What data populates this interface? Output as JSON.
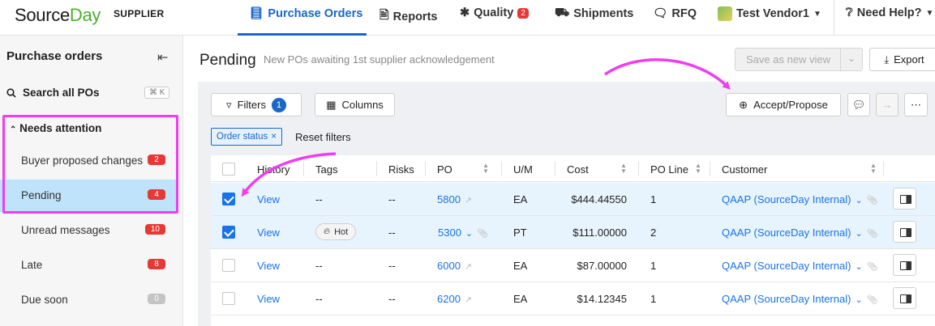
{
  "header": {
    "logo_source": "Source",
    "logo_day": "Day",
    "supplier": "SUPPLIER",
    "nav": [
      {
        "label": "Purchase Orders",
        "icon": "book-icon"
      },
      {
        "label": "Reports",
        "icon": "document-icon"
      },
      {
        "label": "Quality",
        "icon": "bug-icon",
        "badge": "2"
      },
      {
        "label": "Shipments",
        "icon": "truck-icon"
      },
      {
        "label": "RFQ",
        "icon": "chat-icon"
      },
      {
        "label": "Test Vendor1",
        "icon": "vendor-avatar"
      },
      {
        "label": "Need Help?",
        "icon": "help-icon"
      }
    ]
  },
  "sidebar": {
    "title": "Purchase orders",
    "search_label": "Search all POs",
    "search_shortcut": "⌘ K",
    "group_label": "Needs attention",
    "items": [
      {
        "label": "Buyer proposed changes",
        "count": "2"
      },
      {
        "label": "Pending",
        "count": "4"
      },
      {
        "label": "Unread messages",
        "count": "10"
      },
      {
        "label": "Late",
        "count": "8"
      },
      {
        "label": "Due soon",
        "count": "0"
      }
    ]
  },
  "main": {
    "title": "Pending",
    "subtitle": "New POs awaiting 1st supplier acknowledgement",
    "save_view": "Save as new view",
    "export": "Export",
    "filters_label": "Filters",
    "filters_count": "1",
    "columns_label": "Columns",
    "accept_label": "Accept/Propose",
    "chip_label": "Order status",
    "reset_label": "Reset filters"
  },
  "table": {
    "columns": [
      "History",
      "Tags",
      "Risks",
      "PO",
      "U/M",
      "Cost",
      "PO Line",
      "Customer"
    ],
    "rows": [
      {
        "checked": true,
        "history": "View",
        "tags": "--",
        "risks": "--",
        "po": "5800",
        "um": "EA",
        "cost": "$444.44550",
        "po_line": "1",
        "customer": "QAAP (SourceDay Internal)"
      },
      {
        "checked": true,
        "history": "View",
        "tags": "Hot",
        "risks": "--",
        "po": "5300",
        "um": "PT",
        "cost": "$111.00000",
        "po_line": "2",
        "customer": "QAAP (SourceDay Internal)"
      },
      {
        "checked": false,
        "history": "View",
        "tags": "--",
        "risks": "--",
        "po": "6000",
        "um": "EA",
        "cost": "$87.00000",
        "po_line": "1",
        "customer": "QAAP (SourceDay Internal)"
      },
      {
        "checked": false,
        "history": "View",
        "tags": "--",
        "risks": "--",
        "po": "6200",
        "um": "EA",
        "cost": "$14.12345",
        "po_line": "1",
        "customer": "QAAP (SourceDay Internal)"
      }
    ]
  },
  "colors": {
    "accent": "#1a67c8",
    "brand_green": "#4caf2f",
    "highlight": "#f03df0",
    "danger": "#e53935"
  }
}
